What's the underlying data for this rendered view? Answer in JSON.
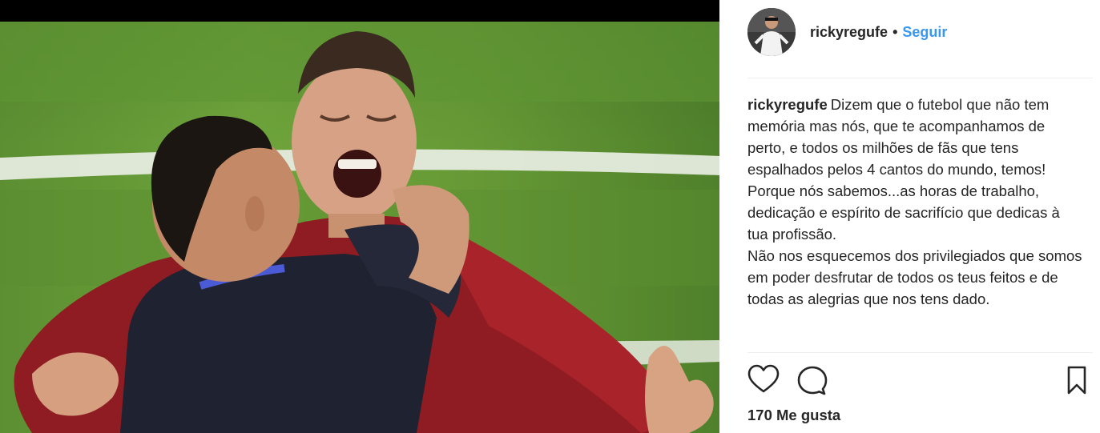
{
  "photo": {
    "icon": "photo-football-celebration"
  },
  "header": {
    "username": "rickyregufe",
    "separator": "•",
    "follow_label": "Seguir",
    "follow_color": "#3897f0"
  },
  "caption": {
    "username": "rickyregufe",
    "text": "Dizem que o futebol que não tem memória mas nós, que te acompanhamos de perto, e todos os milhões de fãs que tens espalhados pelos 4 cantos do mundo, temos!\nPorque nós sabemos...as horas de trabalho, dedicação e espírito de sacrifício que dedicas à tua profissão.\nNão nos esquecemos dos privilegiados que somos em poder desfrutar de todos os teus feitos e de todas as alegrias que nos tens dado."
  },
  "actions": {
    "like_icon": "heart-icon",
    "comment_icon": "comment-icon",
    "save_icon": "bookmark-icon"
  },
  "likes": {
    "text": "170 Me gusta"
  }
}
